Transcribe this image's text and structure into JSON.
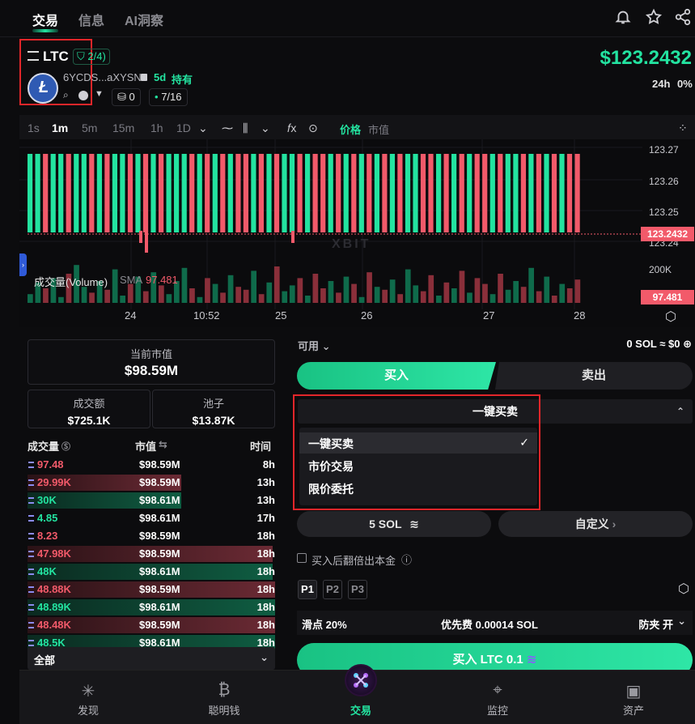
{
  "tabs": [
    "交易",
    "信息",
    "AI洞察"
  ],
  "token": {
    "symbol": "LTC",
    "shield_count": "2/4)",
    "address": "6YCDS...aXYSN",
    "age": "5d",
    "hold_label": "持有",
    "pill_count": "0",
    "pill_holders": "7/16",
    "price": "$123.2432",
    "change_label": "24h",
    "change_value": "0%"
  },
  "chart_toolbar": {
    "timeframes": [
      "1s",
      "1m",
      "5m",
      "15m",
      "1h",
      "1D"
    ],
    "active_timeframe": "1m",
    "price_label": "价格",
    "mcap_label": "市值"
  },
  "chart_data": {
    "type": "bar",
    "price_ticks": [
      "123.27",
      "123.26",
      "123.25",
      "123.24"
    ],
    "current_price": "123.2432",
    "x_ticks": [
      "24",
      "10:52",
      "25",
      "26",
      "27",
      "28"
    ],
    "volume_label": "成交量(Volume)",
    "volume_sma_label": "SMA",
    "volume_sma_value": "97.481",
    "volume_axis_label": "200K",
    "volume_tag": "97.481",
    "watermark": "XBIT",
    "candles": [
      1,
      1,
      0,
      1,
      1,
      0,
      1,
      1,
      0,
      1,
      0,
      1,
      1,
      0,
      1,
      0,
      1,
      0,
      1,
      1,
      1,
      0,
      1,
      0,
      1,
      0,
      1,
      0,
      0,
      1,
      0,
      1,
      0,
      1,
      1,
      0,
      1,
      0,
      0,
      1,
      0,
      1,
      0,
      1,
      0,
      1,
      0,
      1,
      0,
      1,
      1,
      0,
      0,
      1,
      0,
      1,
      0,
      1,
      0,
      0,
      1,
      0,
      1,
      1,
      0,
      1,
      0,
      1,
      0,
      1,
      0,
      0
    ],
    "volumes": [
      12,
      28,
      20,
      34,
      8,
      40,
      52,
      22,
      14,
      30,
      18,
      46,
      10,
      26,
      36,
      16,
      42,
      24,
      12,
      30,
      48,
      20,
      8,
      34,
      26,
      14,
      38,
      22,
      18,
      44,
      12,
      28,
      50,
      16,
      24,
      34,
      10,
      40,
      20,
      30,
      14,
      36,
      26,
      8,
      42,
      22,
      18,
      32,
      12,
      46,
      24,
      16,
      38,
      10,
      28,
      20,
      44,
      14,
      34,
      26,
      12,
      40,
      18,
      30,
      22,
      48,
      16,
      36,
      10,
      26,
      20,
      32
    ]
  },
  "stats": {
    "mcap_label": "当前市值",
    "mcap_value": "$98.59M",
    "turnover_label": "成交额",
    "turnover_value": "$725.1K",
    "pool_label": "池子",
    "pool_value": "$13.87K"
  },
  "trades_head": {
    "vol": "成交量",
    "mcap": "市值",
    "time": "时间"
  },
  "trades": [
    {
      "vol": "97.48",
      "mcap": "$98.59M",
      "time": "8h",
      "side": "sell",
      "fill": 0
    },
    {
      "vol": "29.99K",
      "mcap": "$98.59M",
      "time": "13h",
      "side": "sell",
      "fill": 0.62
    },
    {
      "vol": "30K",
      "mcap": "$98.61M",
      "time": "13h",
      "side": "buy",
      "fill": 0.62
    },
    {
      "vol": "4.85",
      "mcap": "$98.61M",
      "time": "17h",
      "side": "buy",
      "fill": 0
    },
    {
      "vol": "8.23",
      "mcap": "$98.59M",
      "time": "18h",
      "side": "sell",
      "fill": 0
    },
    {
      "vol": "47.98K",
      "mcap": "$98.59M",
      "time": "18h",
      "side": "sell",
      "fill": 0.99
    },
    {
      "vol": "48K",
      "mcap": "$98.61M",
      "time": "18h",
      "side": "buy",
      "fill": 0.99
    },
    {
      "vol": "48.88K",
      "mcap": "$98.59M",
      "time": "18h",
      "side": "sell",
      "fill": 1
    },
    {
      "vol": "48.89K",
      "mcap": "$98.61M",
      "time": "18h",
      "side": "buy",
      "fill": 1
    },
    {
      "vol": "48.48K",
      "mcap": "$98.59M",
      "time": "18h",
      "side": "sell",
      "fill": 1
    },
    {
      "vol": "48.5K",
      "mcap": "$98.61M",
      "time": "18h",
      "side": "buy",
      "fill": 1
    }
  ],
  "filter_all": "全部",
  "trade_panel": {
    "avail_label": "可用",
    "balance": "0 SOL ≈ $0",
    "buy_tab": "买入",
    "sell_tab": "卖出",
    "mode_selected": "一键买卖",
    "mode_options": [
      "一键买卖",
      "市价交易",
      "限价委托"
    ],
    "amount_label": "5 SOL",
    "custom_label": "自定义",
    "double_label": "买入后翻倍出本金",
    "presets": [
      "P1",
      "P2",
      "P3"
    ],
    "slippage": "滑点 20%",
    "priority_fee": "优先费 0.00014 SOL",
    "mev": "防夹 开",
    "buy_button": "买入 LTC 0.1"
  },
  "bottom_nav": [
    "发现",
    "聪明钱",
    "交易",
    "监控",
    "资产"
  ],
  "colors": {
    "green": "#23e3a0",
    "red": "#f25a6a",
    "highlight": "#e2262a"
  }
}
